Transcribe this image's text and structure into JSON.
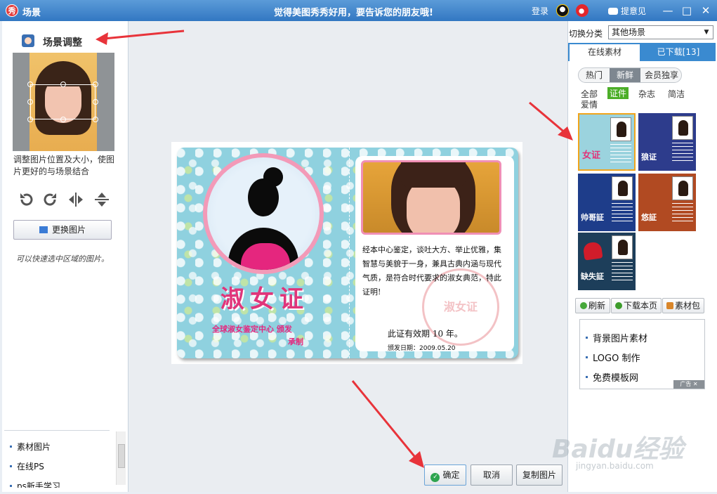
{
  "titlebar": {
    "app_icon_text": "秀",
    "title": "场景",
    "slogan": "觉得美图秀秀好用，要告诉您的朋友哦!",
    "login": "登录",
    "feedback": "提意见",
    "minimize": "—",
    "maximize": "□",
    "close": "✕"
  },
  "left": {
    "section_title": "场景调整",
    "hint": "调整图片位置及大小，使图片更好的与场景结合",
    "change_image": "更换图片",
    "handwritten_note": "可以快速选中区域的图片。",
    "links": [
      "素材图片",
      "在线PS",
      "ps新手学习"
    ]
  },
  "card": {
    "title": "淑女证",
    "issuer": "全球淑女鉴定中心  颁发",
    "issuer_sub": "承制",
    "body": "经本中心鉴定，谈吐大方、举止优雅，集智慧与美貌于一身，兼具古典内涵与现代气质，是符合时代要求的淑女典范，特此证明!",
    "validity": "此证有效期  10  年。",
    "issue_date": "颁发日期：2009.05.20",
    "stamp": "淑女证"
  },
  "buttons": {
    "confirm": "确定",
    "cancel": "取消",
    "copy": "复制图片"
  },
  "right": {
    "switch_label": "切换分类",
    "category_selected": "其他场景",
    "tabs": {
      "online": "在线素材",
      "downloaded": "已下载[13]"
    },
    "subtabs": [
      "热门",
      "新鲜",
      "会员独享"
    ],
    "filters": [
      "全部",
      "证件",
      "杂志",
      "简洁",
      "爱情"
    ],
    "active_filter": "证件",
    "thumbs": [
      "女证",
      "狼证",
      "帅哥証",
      "悠証",
      "缺失証"
    ],
    "actions": {
      "refresh": "刷新",
      "download_page": "下载本页",
      "material_pack": "素材包"
    },
    "ads": [
      "背景图片素材",
      "LOGO 制作",
      "免费模板网"
    ],
    "ad_tag": "广告 ✕"
  },
  "watermark": {
    "brand": "Baidu经验",
    "url": "jingyan.baidu.com"
  },
  "colors": {
    "titlebar": "#3277c2",
    "accent_red": "#e8333a",
    "card_pink": "#e0357a",
    "tab_blue": "#3a8ad0"
  }
}
